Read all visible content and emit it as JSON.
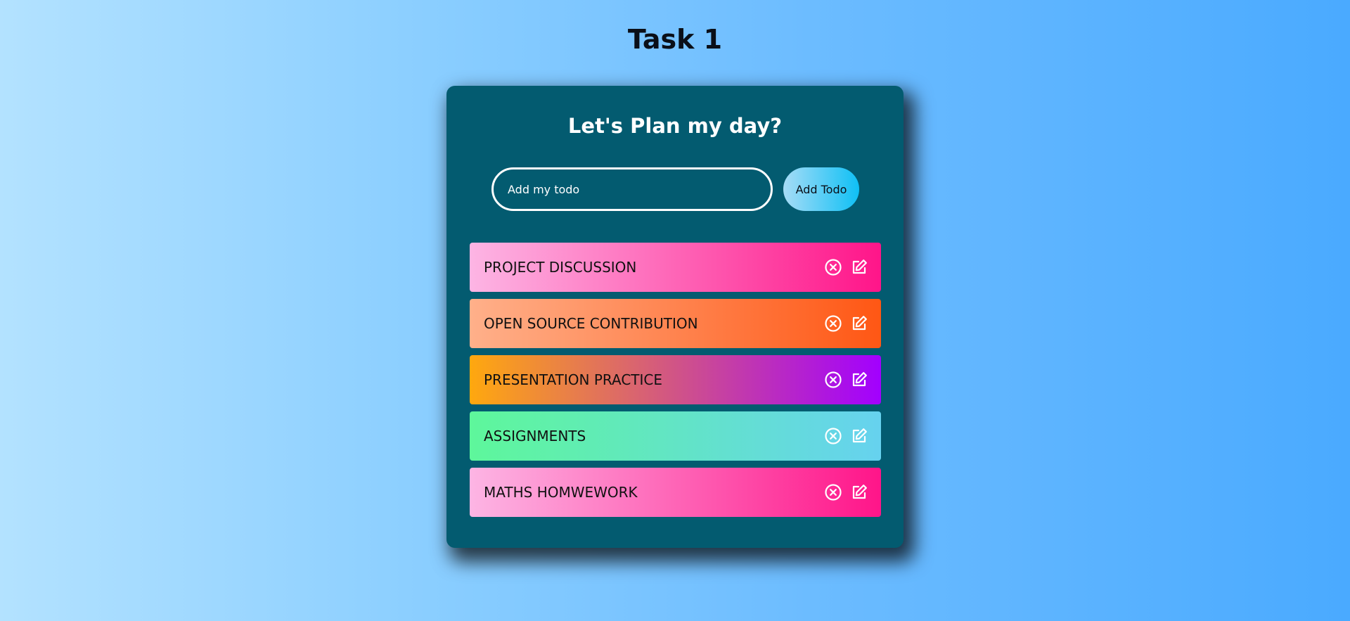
{
  "page": {
    "title": "Task 1"
  },
  "card": {
    "title": "Let's Plan my day?",
    "input": {
      "placeholder": "Add my todo",
      "value": ""
    },
    "add_button_label": "Add Todo"
  },
  "todos": [
    {
      "label": "PROJECT DISCUSSION",
      "gradient": [
        "#fdb5e4",
        "#ff1589"
      ]
    },
    {
      "label": "OPEN SOURCE CONTRIBUTION",
      "gradient": [
        "#ffb08a",
        "#ff5714"
      ]
    },
    {
      "label": "PRESENTATION PRACTICE",
      "gradient": [
        "#ffa80e",
        "#a200ff"
      ]
    },
    {
      "label": "ASSIGNMENTS",
      "gradient": [
        "#5ef79b",
        "#66d2ef"
      ]
    },
    {
      "label": "MATHS HOMWEWORK",
      "gradient": [
        "#fdb5e4",
        "#ff1589"
      ]
    }
  ],
  "icons": {
    "delete": "circle-x-icon",
    "edit": "edit-icon"
  },
  "colors": {
    "card_background": "#035b70",
    "icon_color": "#ffffff"
  }
}
